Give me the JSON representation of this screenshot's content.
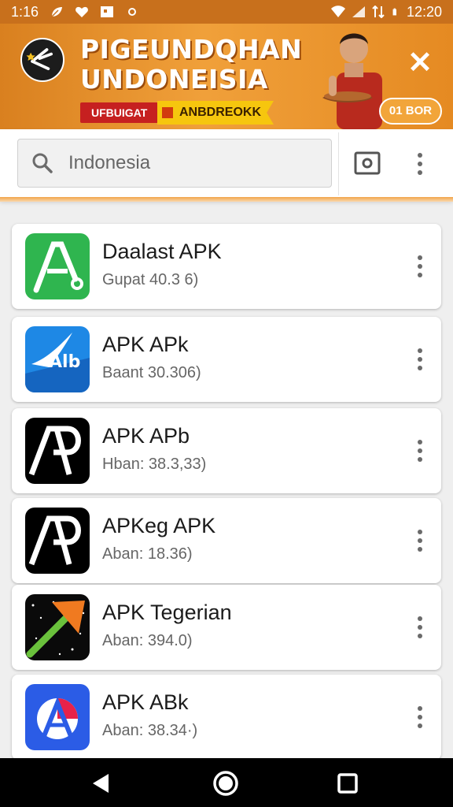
{
  "status_bar": {
    "time_left": "1:16",
    "time_right": "12:20"
  },
  "banner": {
    "title_line1": "PIGEUNDQHAN",
    "title_line2": "UNDONEISIA",
    "tag_red": "UFBUIGAT",
    "tag_yellow": "ANBDREOKK",
    "pill": "01 BOR",
    "close": "✕"
  },
  "search": {
    "placeholder": "Indonesia",
    "value": ""
  },
  "apps": [
    {
      "name": "Daalast APK",
      "meta": "Gupat 40.3 6)",
      "icon": "a-green-icon"
    },
    {
      "name": "APK APk",
      "meta": "Baant 30.306)",
      "icon": "alb-blue-icon"
    },
    {
      "name": "APK APb",
      "meta": "Hban: 38.3,33)",
      "icon": "ap-black-icon"
    },
    {
      "name": "APKeg APK",
      "meta": "Aban: 18.36)",
      "icon": "ap-black-icon"
    },
    {
      "name": "APK Tegerian",
      "meta": "Aban: 394.0)",
      "icon": "arrow-stars-icon"
    },
    {
      "name": "APK ABk",
      "meta": "Aban: 38.34·)",
      "icon": "a-circle-blue-icon"
    }
  ],
  "colors": {
    "banner_orange": "#e58a22",
    "status_bar": "#c8701c",
    "tag_red": "#c62020",
    "tag_yellow": "#f6c60e"
  }
}
